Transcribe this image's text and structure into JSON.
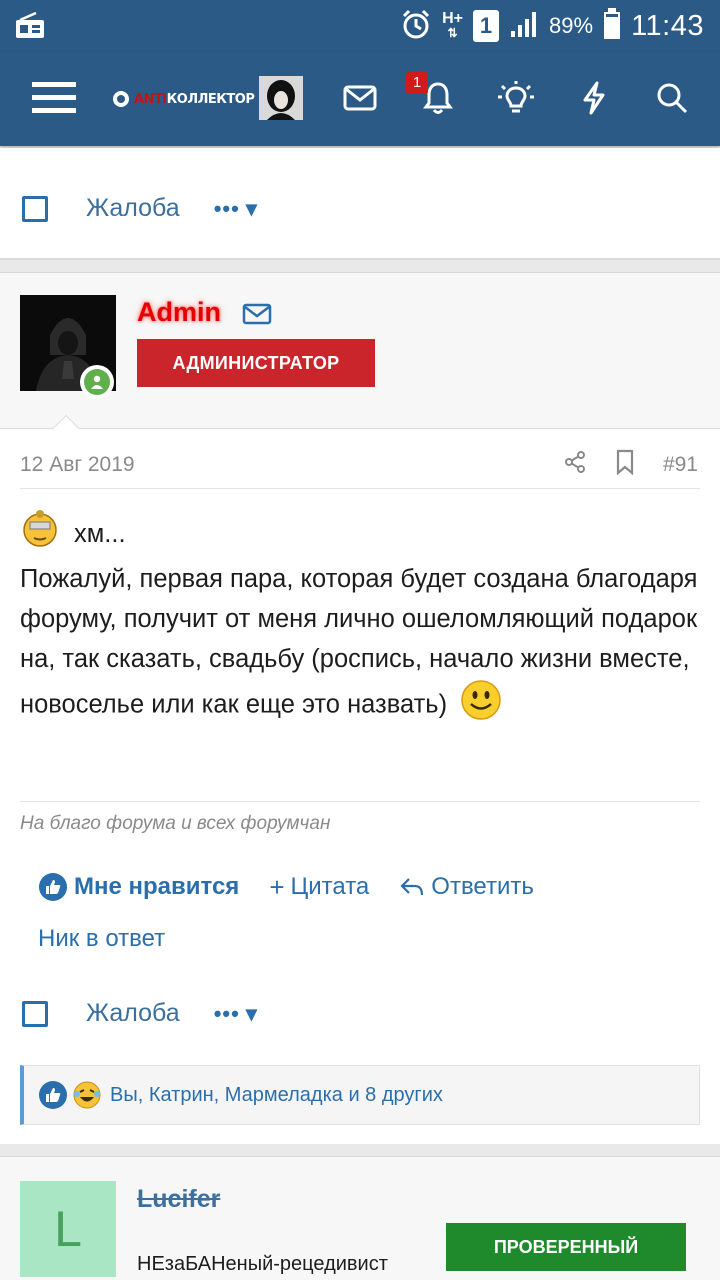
{
  "status_bar": {
    "network": "H+",
    "sim": "1",
    "battery": "89%",
    "time": "11:43"
  },
  "header": {
    "logo_text_red": "ANTI",
    "logo_text": "КОЛЛЕКТОР",
    "notification_count": "1",
    "icons": [
      "menu-icon",
      "mail-icon",
      "bell-icon",
      "bulb-icon",
      "lightning-icon",
      "search-icon"
    ]
  },
  "top_actions": {
    "report": "Жалоба",
    "more": "•••"
  },
  "post": {
    "author": "Admin",
    "role": "АДМИНИСТРАТОР",
    "date": "12 Авг 2019",
    "number": "#91",
    "first_line": "хм...",
    "body": "Пожалуй, первая пара, которая будет создана благодаря форуму, получит от меня лично ошеломляющий подарок на, так сказать, свадьбу (роспись, начало жизни вместе, новоселье или как еще это назвать)",
    "signature": "На благо форума и всех форумчан",
    "actions": {
      "like": "Мне нравится",
      "quote": "Цитата",
      "reply": "Ответить",
      "nick_reply": "Ник в ответ",
      "report": "Жалоба",
      "more": "•••"
    },
    "reactions_text": "Вы, Катрин, Мармеладка и 8 других"
  },
  "next_post": {
    "avatar_letter": "L",
    "author": "Lucifer",
    "title": "НЕзаБАНеный-рецедивист",
    "badge": "ПРОВЕРЕННЫЙ"
  }
}
